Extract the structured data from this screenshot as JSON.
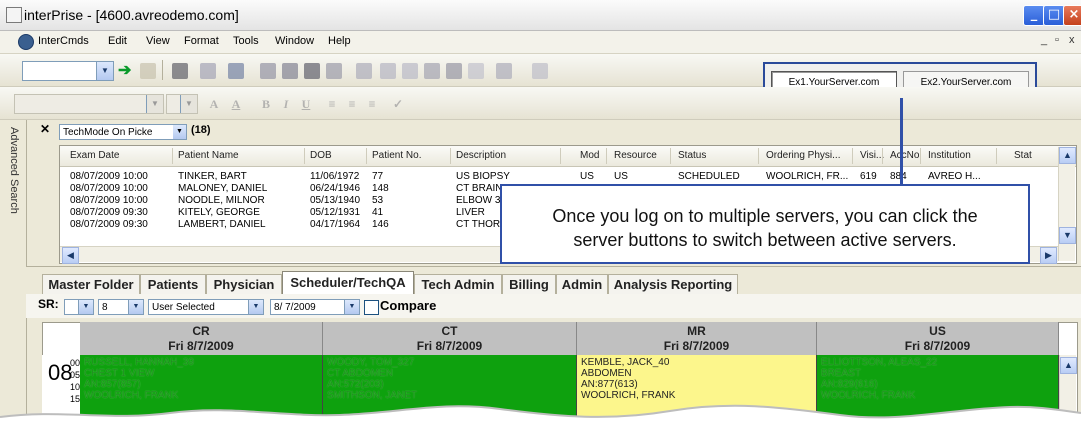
{
  "window": {
    "title": "interPrise - [4600.avreodemo.com]",
    "app_icon_text": "avreo"
  },
  "menu": {
    "items": [
      "InterCmds",
      "Edit",
      "View",
      "Format",
      "Tools",
      "Window",
      "Help"
    ],
    "mdi_controls": [
      "_",
      "▫",
      "x"
    ]
  },
  "servers": {
    "buttons": [
      "Ex1.YourServer.com",
      "Ex2.YourServer.com"
    ]
  },
  "side_panel": {
    "label": "Advanced Search"
  },
  "search": {
    "mode": "TechMode On Picke",
    "count": "(18)",
    "columns": [
      "Exam Date",
      "Patient Name",
      "DOB",
      "Patient No.",
      "Description",
      "Mod",
      "Resource",
      "Status",
      "Ordering Physi...",
      "Visi...",
      "AccNo",
      "Institution",
      "Stat"
    ],
    "rows": [
      [
        "08/07/2009 10:00",
        "TINKER, BART",
        "11/06/1972",
        "77",
        "US BIOPSY",
        "US",
        "US",
        "SCHEDULED",
        "WOOLRICH, FR...",
        "619",
        "884",
        "AVREO H..."
      ],
      [
        "08/07/2009 10:00",
        "MALONEY, DANIEL",
        "06/24/1946",
        "148",
        "CT BRAIN",
        "",
        "",
        "",
        "",
        "",
        "",
        ""
      ],
      [
        "08/07/2009 10:00",
        "NOODLE, MILNOR",
        "05/13/1940",
        "53",
        "ELBOW 3",
        "",
        "",
        "",
        "",
        "",
        "",
        ""
      ],
      [
        "08/07/2009 09:30",
        "KITELY, GEORGE",
        "05/12/1931",
        "41",
        "LIVER",
        "",
        "",
        "",
        "",
        "",
        "",
        ""
      ],
      [
        "08/07/2009 09:30",
        "LAMBERT, DANIEL",
        "04/17/1964",
        "146",
        "CT THORA",
        "",
        "",
        "",
        "",
        "",
        "",
        ""
      ]
    ]
  },
  "callout": {
    "line1": "Once you log on to multiple servers, you can click the",
    "line2": "server buttons to switch between active servers."
  },
  "tabs": [
    "Master Folder",
    "Patients",
    "Physician",
    "Scheduler/TechQA",
    "Tech Admin",
    "Billing",
    "Admin",
    "Analysis Reporting"
  ],
  "active_tab": "Scheduler/TechQA",
  "scheduler": {
    "sr_label": "SR:",
    "sr_value": "",
    "count_value": "8",
    "mode_value": "User Selected",
    "date_value": "8/ 7/2009",
    "compare_label": "Compare",
    "hour": "08",
    "minutes": [
      "00",
      "05",
      "10",
      "15"
    ],
    "columns": [
      {
        "modality": "CR",
        "date": "Fri 8/7/2009",
        "color": "#0ea10e",
        "lines": [
          "RUSSELL, HANNAH_39",
          "CHEST 1 VIEW",
          "AN:857(857)",
          "WOOLRICH, FRANK"
        ]
      },
      {
        "modality": "CT",
        "date": "Fri 8/7/2009",
        "color": "#0ea10e",
        "lines": [
          "WOODY, TOM_327",
          "CT ABDOMEN",
          "AN:572(203)",
          "SMITHSON, JANET"
        ]
      },
      {
        "modality": "MR",
        "date": "Fri 8/7/2009",
        "color": "#fcf68c",
        "lines": [
          "KEMBLE, JACK_40",
          "ABDOMEN",
          "AN:877(613)",
          "WOOLRICH, FRANK"
        ]
      },
      {
        "modality": "US",
        "date": "Fri 8/7/2009",
        "color": "#0ea10e",
        "lines": [
          "ELLIOTTSON, ALEAS_22",
          "BREAST",
          "AN:829(616)",
          "WOOLRICH, FRANK"
        ]
      }
    ]
  }
}
